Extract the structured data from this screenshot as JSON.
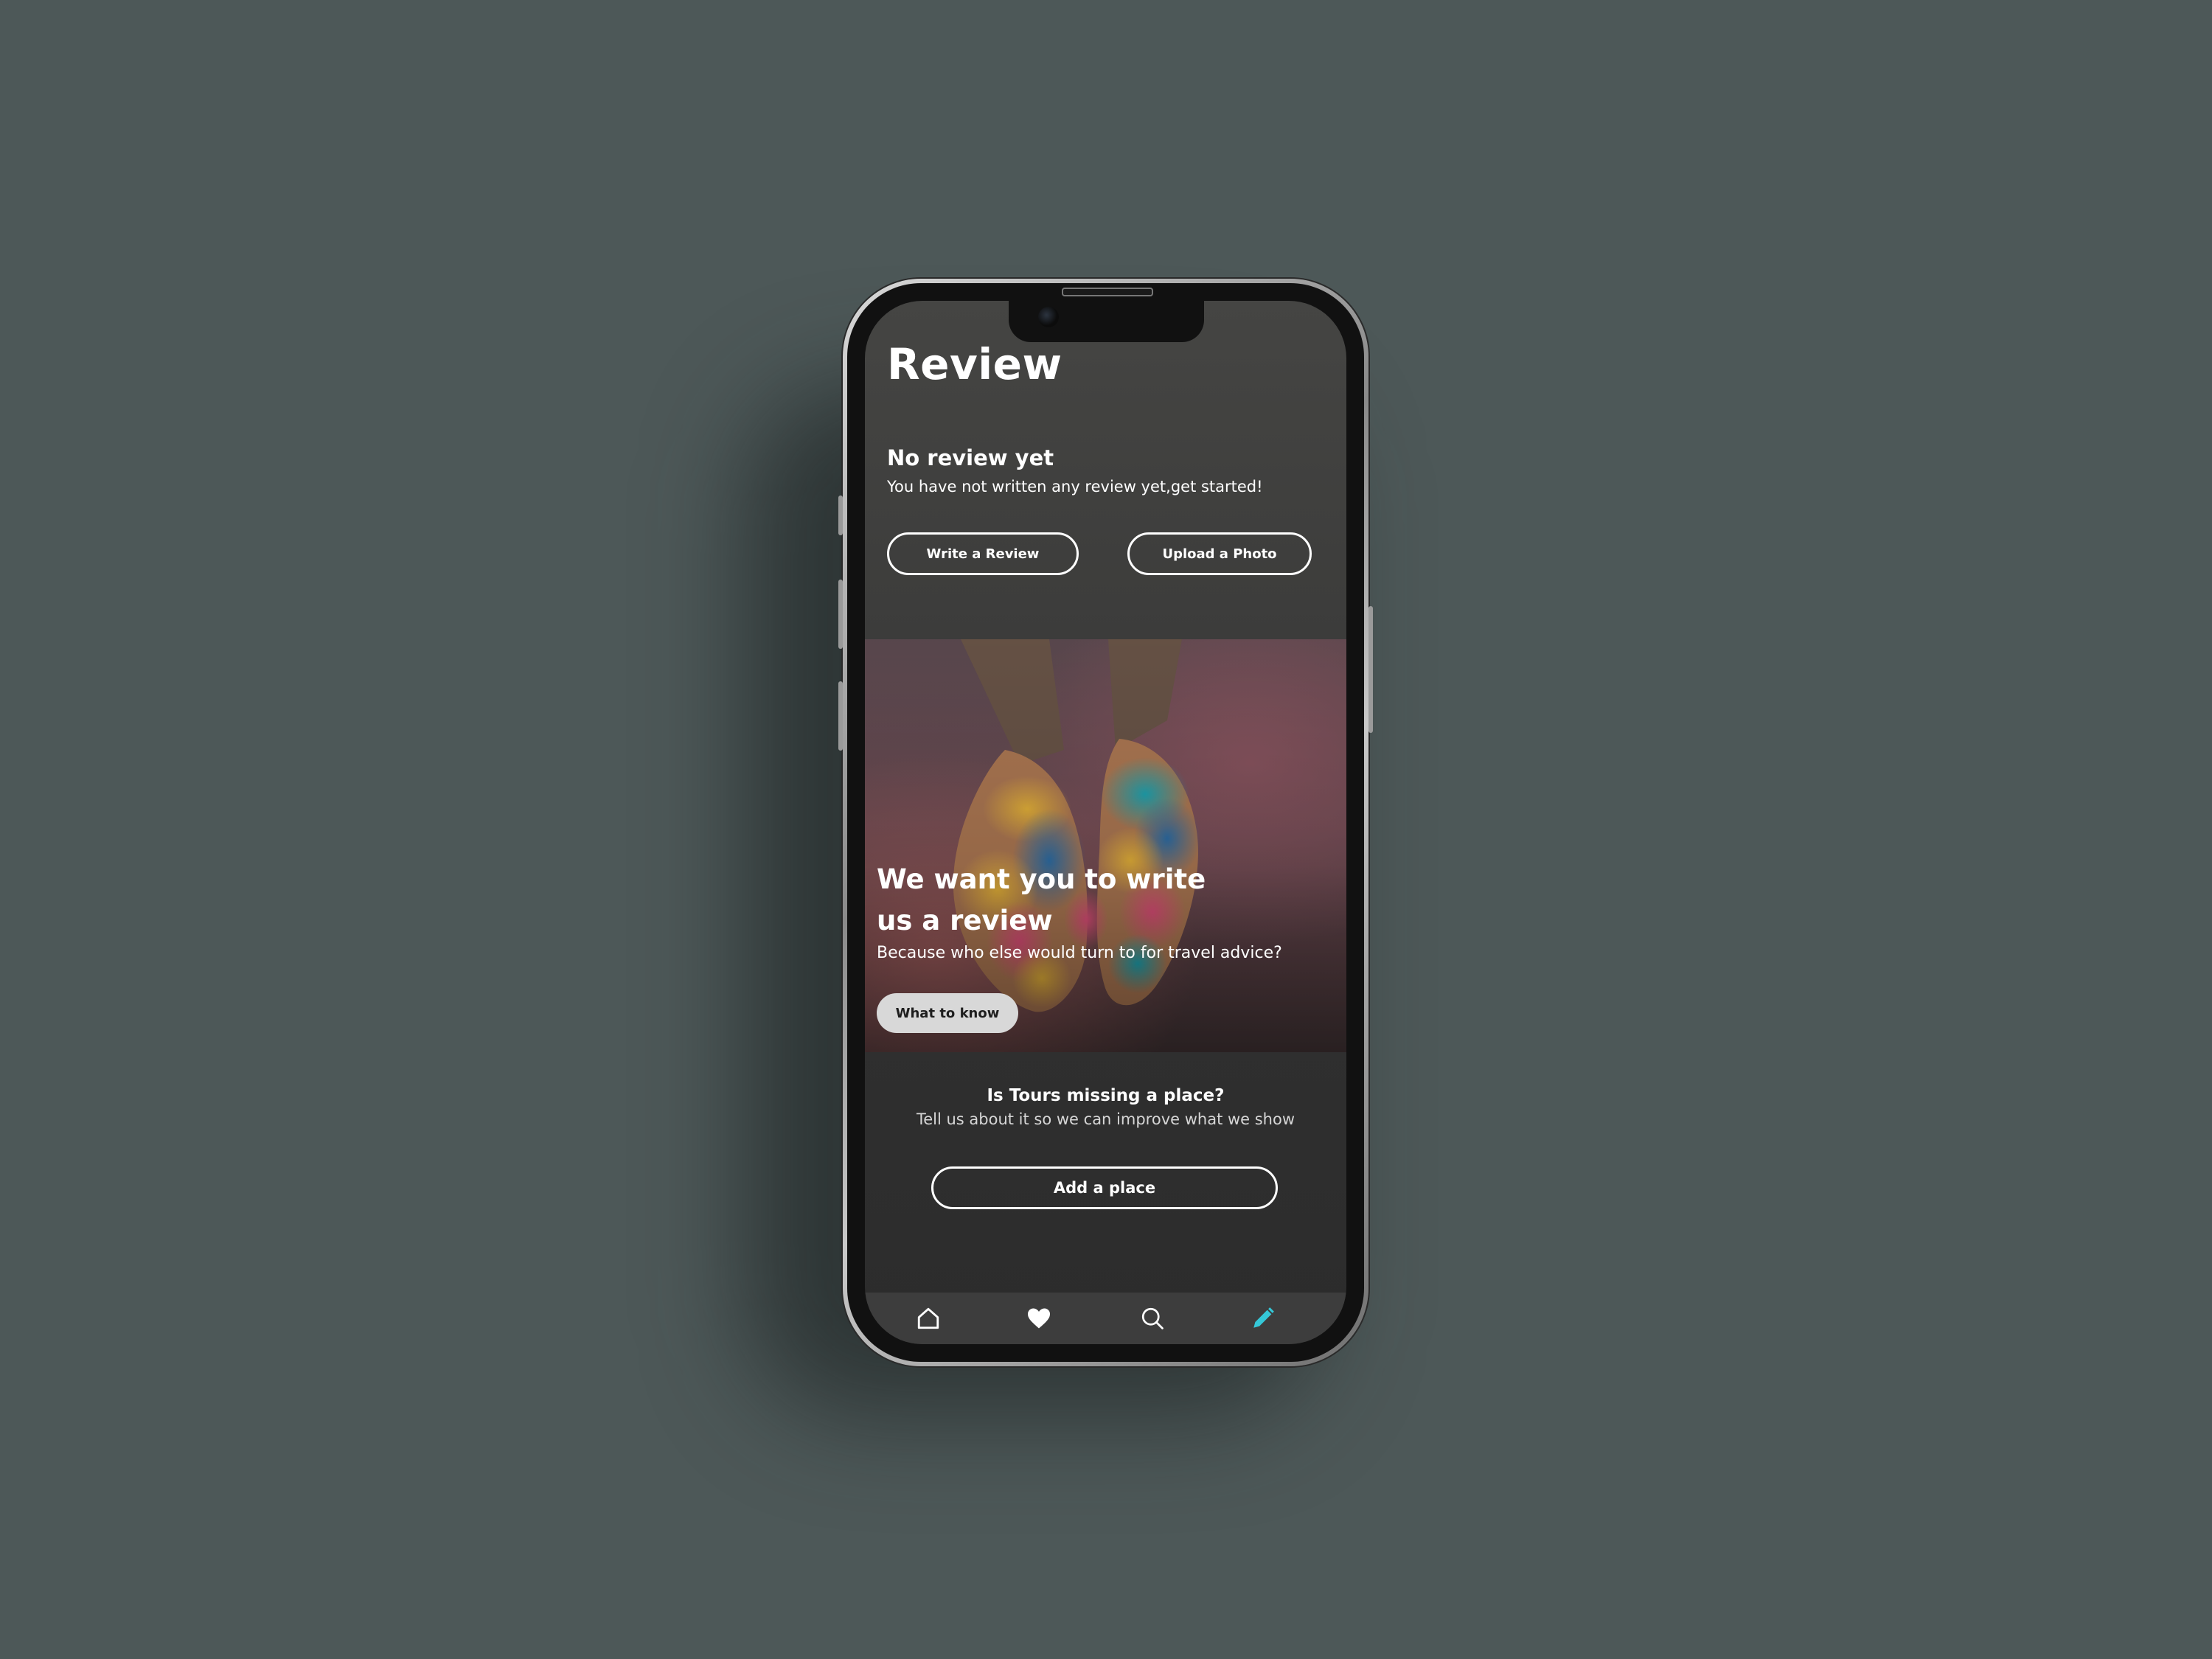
{
  "header": {
    "title": "Review"
  },
  "empty_state": {
    "title": "No review yet",
    "description": "You have not written any review yet,get started!",
    "write_button": "Write a Review",
    "upload_button": "Upload a Photo"
  },
  "hero": {
    "headline": "We want you to write us a review",
    "subtitle": "Because who else would turn to for travel advice?",
    "button": "What to know"
  },
  "missing_place": {
    "title": "Is Tours missing a place?",
    "description": "Tell us about it so we can improve what we show",
    "button": "Add a place"
  },
  "tabbar": {
    "items": [
      {
        "icon": "home-icon",
        "active": false
      },
      {
        "icon": "heart-icon",
        "active": false
      },
      {
        "icon": "search-icon",
        "active": false
      },
      {
        "icon": "pencil-icon",
        "active": true
      }
    ]
  },
  "colors": {
    "background": "#4d5858",
    "screen": "#3a3a39",
    "text": "#ffffff",
    "active_tab": "#35c8d8",
    "hero_button": "#d8d8d8"
  }
}
